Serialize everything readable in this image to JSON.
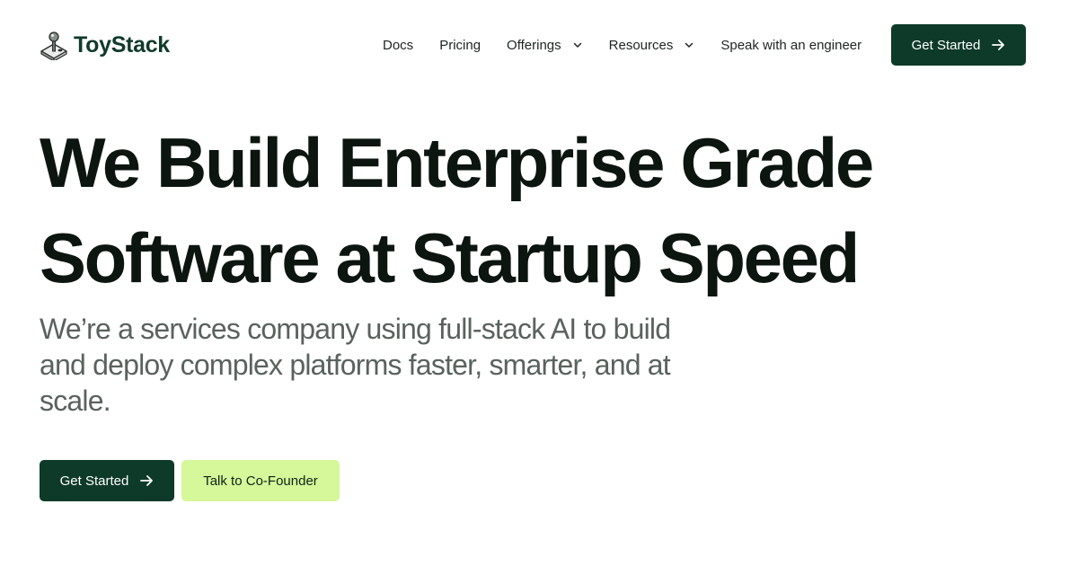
{
  "brand": {
    "name": "ToyStack",
    "icon": "joystick-icon"
  },
  "nav": {
    "items": [
      {
        "label": "Docs",
        "dropdown": false
      },
      {
        "label": "Pricing",
        "dropdown": false
      },
      {
        "label": "Offerings",
        "dropdown": true
      },
      {
        "label": "Resources",
        "dropdown": true
      },
      {
        "label": "Speak with an engineer",
        "dropdown": false
      }
    ],
    "cta_label": "Get Started"
  },
  "hero": {
    "title_line1": "We Build Enterprise Grade",
    "title_line2": "Software at Startup Speed",
    "subtitle": "We’re a services company using full-stack AI to build and deploy complex platforms faster, smarter, and at scale.",
    "primary_label": "Get Started",
    "secondary_label": "Talk to Co-Founder"
  },
  "colors": {
    "brand_dark": "#0e3a2a",
    "accent_lime": "#d6f79a",
    "text_dark": "#0c1510",
    "text_muted": "#5a625d"
  }
}
